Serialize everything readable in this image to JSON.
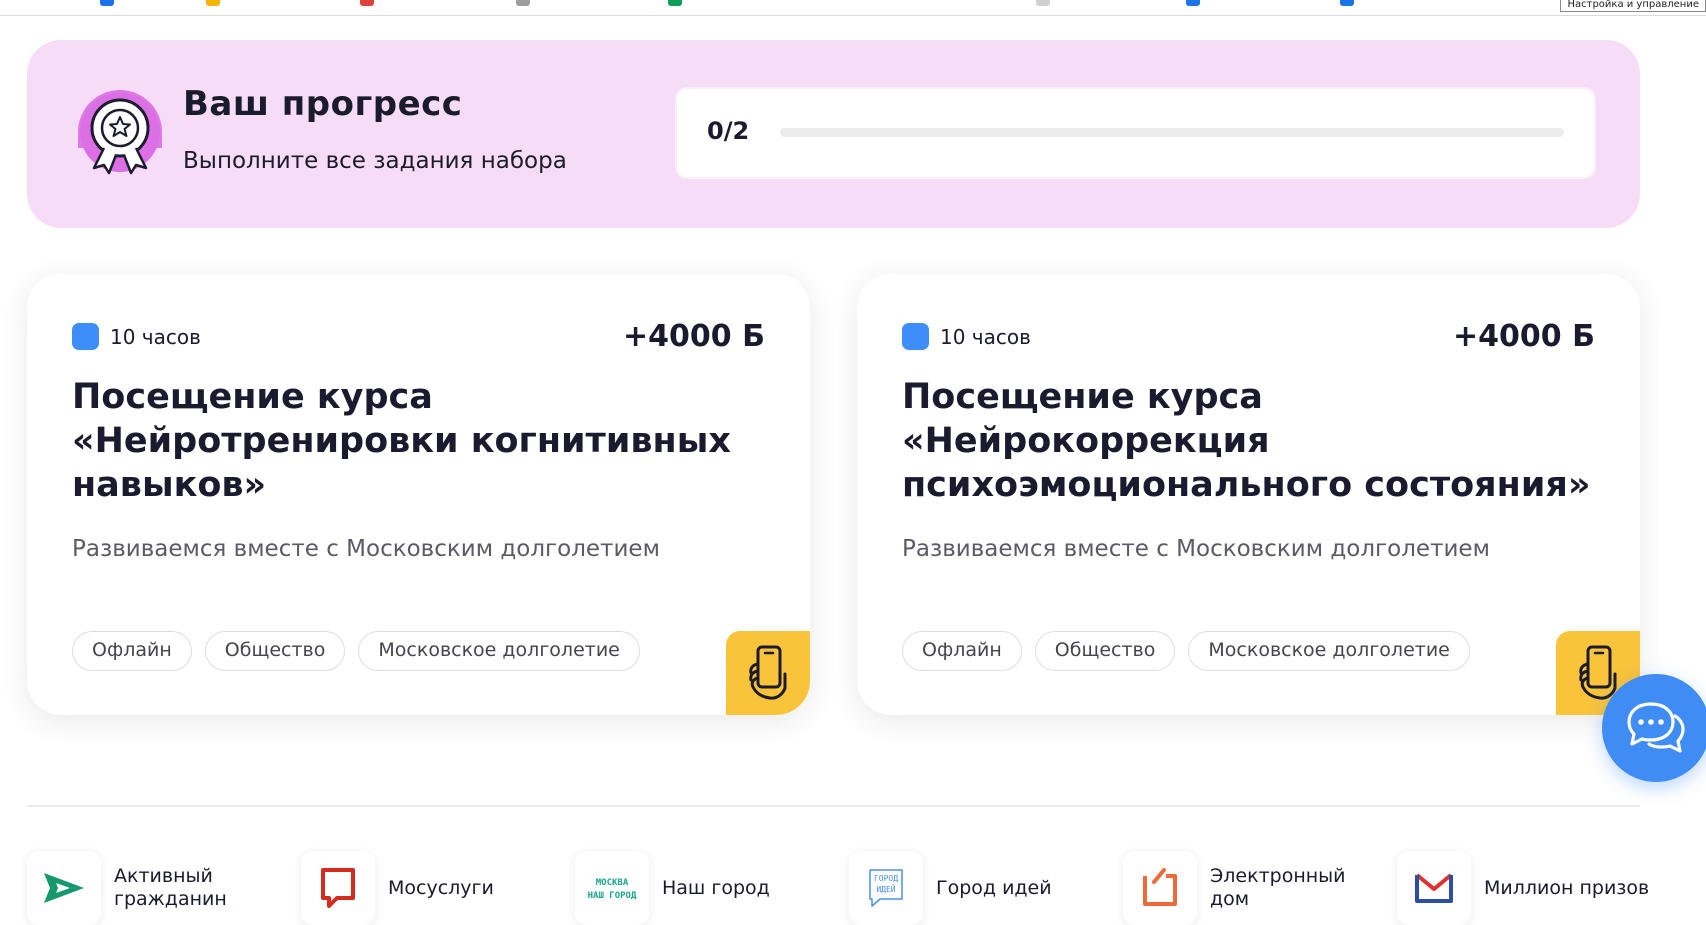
{
  "browser": {
    "bookmark_colors": [
      "#1a73e8",
      "#f4b400",
      "#db4437",
      "#9e9e9e",
      "#0f9d58",
      "#9e9e9e",
      "#1a73e8",
      "#1a73e8"
    ],
    "tooltip": "Настройка и управление"
  },
  "progress": {
    "title": "Ваш прогресс",
    "subtitle": "Выполните все задания набора",
    "count_text": "0/2",
    "completed": 0,
    "total": 2
  },
  "cards": [
    {
      "duration": "10 часов",
      "points": "+4000 Б",
      "title": "Посещение курса «Нейротренировки когнитивных навыков»",
      "description": "Развиваемся вместе с Московским долголетием",
      "tags": [
        "Офлайн",
        "Общество",
        "Московское долголетие"
      ],
      "corner_icon": "phone-in-hand-icon"
    },
    {
      "duration": "10 часов",
      "points": "+4000 Б",
      "title": "Посещение курса «Нейрокоррекция психоэмоционального состояния»",
      "description": "Развиваемся вместе с Московским долголетием",
      "tags": [
        "Офлайн",
        "Общество",
        "Московское долголетие"
      ],
      "corner_icon": "phone-in-hand-icon"
    }
  ],
  "chat": {
    "icon": "chat-bubbles-icon"
  },
  "footer": {
    "projects": [
      {
        "label": "Активный гражданин",
        "icon": "active-citizen-logo"
      },
      {
        "label": "Мосуслуги",
        "icon": "mosuslugi-logo"
      },
      {
        "label": "Наш город",
        "icon": "nash-gorod-logo",
        "logo_text_1": "МОСКВА",
        "logo_text_2": "НАШ ГОРОД"
      },
      {
        "label": "Город идей",
        "icon": "gorod-idey-logo",
        "logo_text_1": "ГОРОД",
        "logo_text_2": "ИДЕЙ"
      },
      {
        "label": "Электронный дом",
        "icon": "electronic-house-logo"
      },
      {
        "label": "Миллион призов",
        "icon": "million-prizes-logo"
      }
    ]
  },
  "colors": {
    "panel_pink": "#f7dcf7",
    "accent_blue": "#3d8ef8",
    "accent_yellow": "#f9c33a",
    "text_dark": "#1b1b2f"
  }
}
